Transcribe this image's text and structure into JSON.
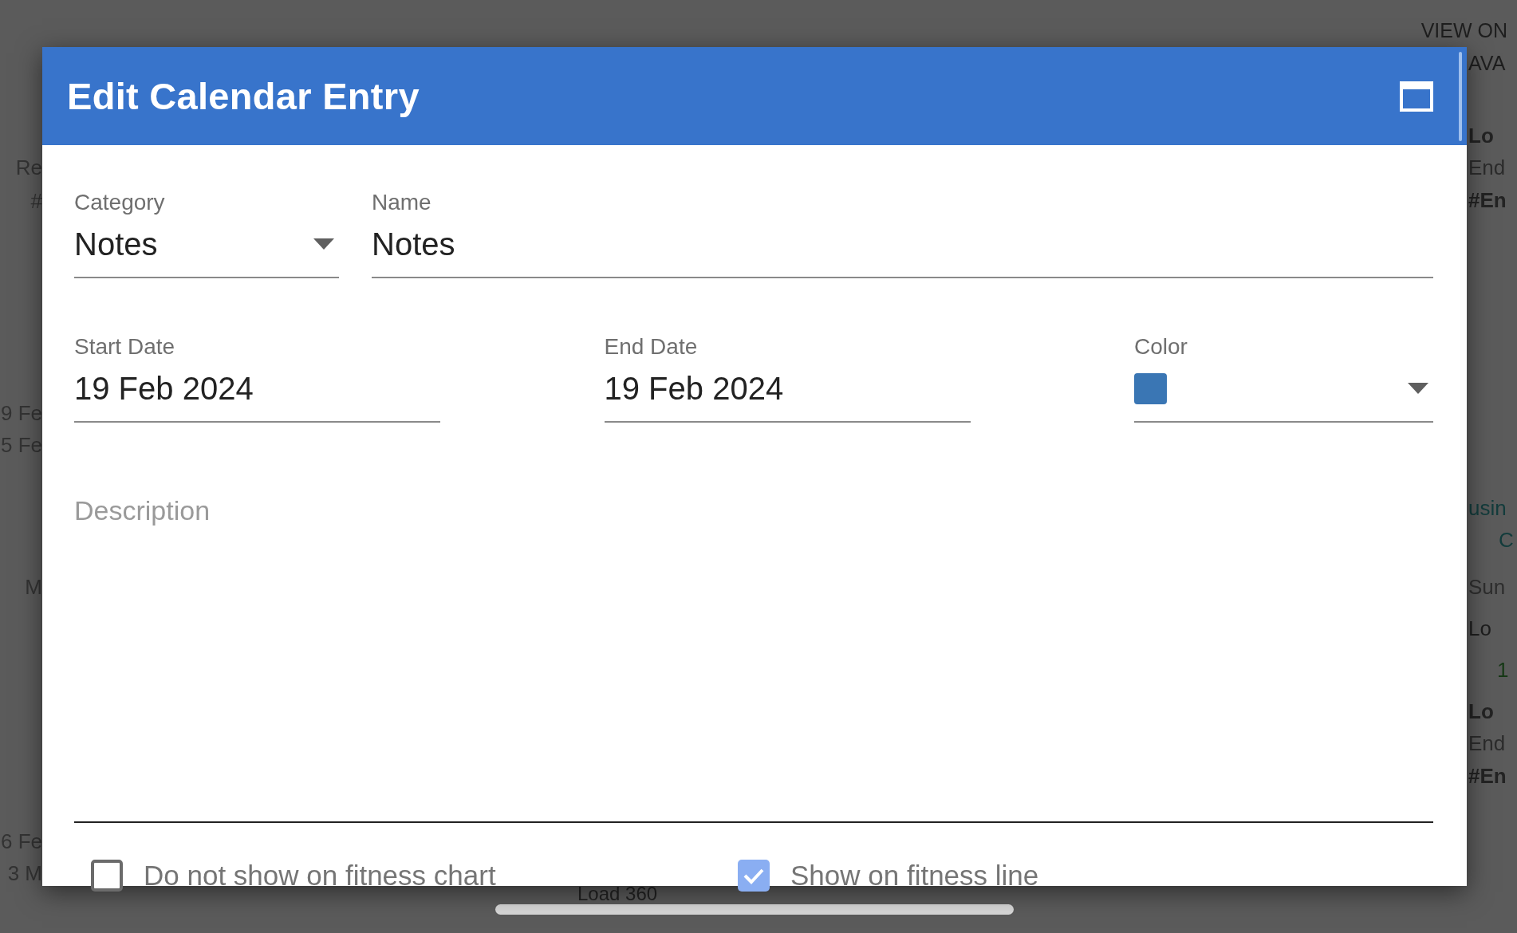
{
  "background": {
    "top_bar": {
      "link": "VIEW ON"
    },
    "left_fragments": [
      "Re",
      "#",
      "9 Fe",
      "5 Fe",
      "M",
      "6 Fe",
      "3 M"
    ],
    "right_fragments": [
      {
        "text": "AVA",
        "kind": "link"
      },
      {
        "text": "Lo",
        "kind": "bold"
      },
      {
        "text": "End",
        "kind": "muted"
      },
      {
        "text": "#En",
        "kind": "bold"
      },
      {
        "text": "usin",
        "kind": "teal"
      },
      {
        "text": "C",
        "kind": "teal"
      },
      {
        "text": "Sun",
        "kind": "faint"
      },
      {
        "text": "Lo",
        "kind": "plain"
      },
      {
        "text": "1",
        "kind": "green"
      },
      {
        "text": "Lo",
        "kind": "bold"
      },
      {
        "text": "End",
        "kind": "muted"
      },
      {
        "text": "#En",
        "kind": "bold"
      }
    ],
    "bottom_fragment": "Load 360"
  },
  "dialog": {
    "title": "Edit Calendar Entry",
    "row_1": [
      {
        "kind": "select",
        "label": "Category",
        "value": "Notes"
      },
      {
        "kind": "text",
        "label": "Name",
        "value": "Notes"
      }
    ],
    "row_2": [
      {
        "kind": "text",
        "label": "Start Date",
        "value": "19 Feb 2024"
      },
      {
        "kind": "text",
        "label": "End Date",
        "value": "19 Feb 2024"
      },
      {
        "kind": "color",
        "label": "Color",
        "color": "#3a76b4"
      }
    ],
    "description": {
      "placeholder": "Description"
    },
    "checkboxes": [
      {
        "label": "Do not show on fitness chart",
        "checked": false
      },
      {
        "label": "Show on fitness line",
        "checked": true
      }
    ]
  }
}
